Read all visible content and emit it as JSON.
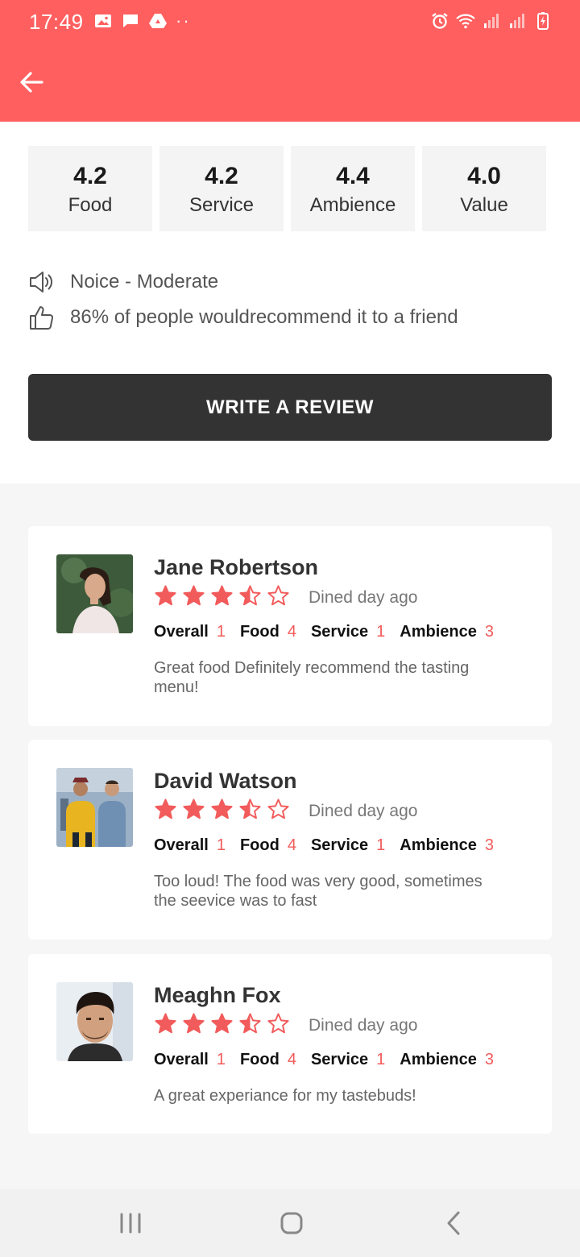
{
  "status_bar": {
    "time": "17:49",
    "icons_left": [
      "image-icon",
      "message-icon",
      "drive-icon",
      "more-dots"
    ],
    "icons_right": [
      "alarm-icon",
      "wifi-icon",
      "signal-icon",
      "signal-icon",
      "battery-charging-icon"
    ]
  },
  "app_bar": {
    "back_icon": "arrow-left-icon",
    "color": "#ff5f5f"
  },
  "scores": [
    {
      "value": "4.2",
      "label": "Food"
    },
    {
      "value": "4.2",
      "label": "Service"
    },
    {
      "value": "4.4",
      "label": "Ambience"
    },
    {
      "value": "4.0",
      "label": "Value"
    }
  ],
  "info": {
    "noise": "Noice - Moderate",
    "noise_icon": "speaker-icon",
    "recommend": "86% of people wouldrecommend it to a friend",
    "recommend_icon": "thumbs-up-icon"
  },
  "write_review_label": "WRITE A REVIEW",
  "reviews": [
    {
      "name": "Jane Robertson",
      "stars": 3.5,
      "dined": "Dined day ago",
      "ratings": [
        {
          "label": "Overall",
          "value": "1"
        },
        {
          "label": "Food",
          "value": "4"
        },
        {
          "label": "Service",
          "value": "1"
        },
        {
          "label": "Ambience",
          "value": "3"
        }
      ],
      "comment": "Great food Definitely recommend the tasting menu!"
    },
    {
      "name": "David Watson",
      "stars": 3.5,
      "dined": "Dined day ago",
      "ratings": [
        {
          "label": "Overall",
          "value": "1"
        },
        {
          "label": "Food",
          "value": "4"
        },
        {
          "label": "Service",
          "value": "1"
        },
        {
          "label": "Ambience",
          "value": "3"
        }
      ],
      "comment": "Too loud! The food was very good, sometimes the seevice was to  fast"
    },
    {
      "name": "Meaghn Fox",
      "stars": 3.5,
      "dined": "Dined day ago",
      "ratings": [
        {
          "label": "Overall",
          "value": "1"
        },
        {
          "label": "Food",
          "value": "4"
        },
        {
          "label": "Service",
          "value": "1"
        },
        {
          "label": "Ambience",
          "value": "3"
        }
      ],
      "comment": "A great experiance for my tastebuds!"
    }
  ],
  "colors": {
    "accent": "#ff5f5f",
    "star": "#f25b5b",
    "button": "#333333"
  },
  "nav_bar": {
    "icons": [
      "recents-icon",
      "home-icon",
      "back-icon"
    ]
  }
}
